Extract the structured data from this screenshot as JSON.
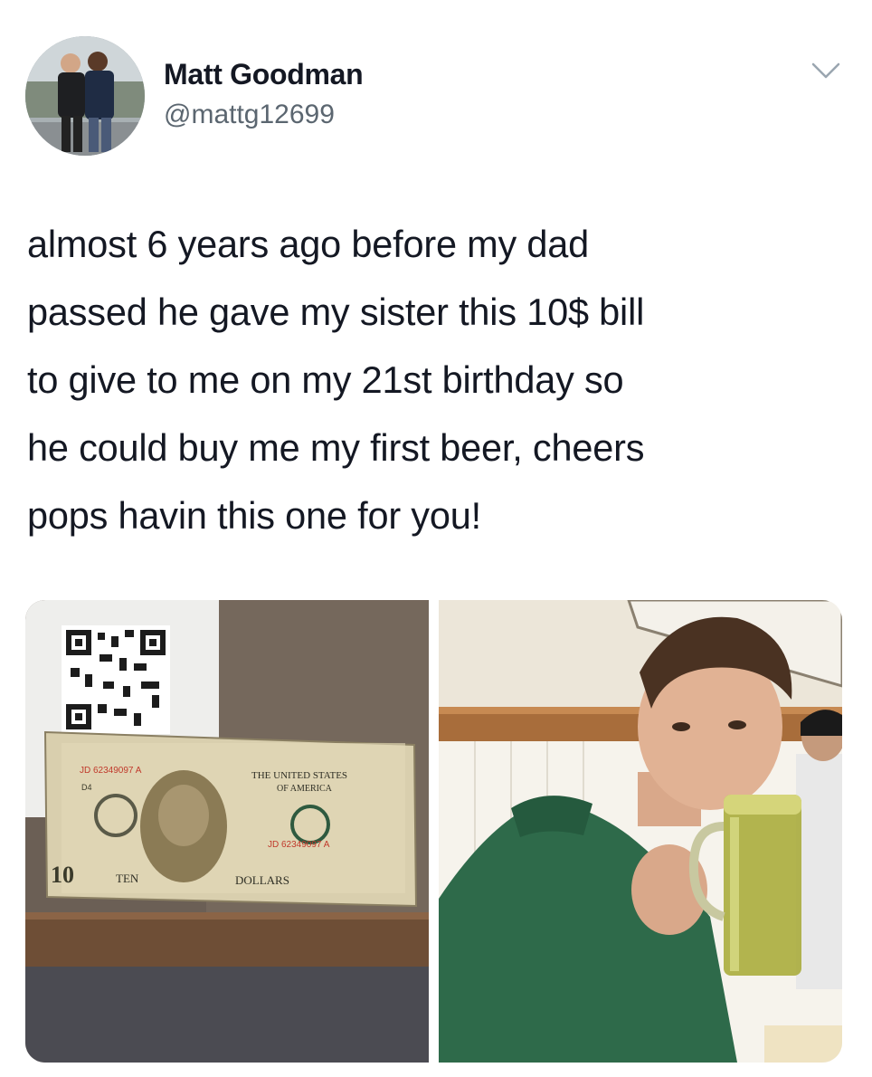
{
  "author": {
    "name": "Matt Goodman",
    "handle": "@mattg12699"
  },
  "tweet": {
    "lines": [
      "almost 6 years ago before my dad",
      "passed he gave my sister this 10$ bill",
      "to give to me on my 21st birthday so",
      "he could buy me my first beer, cheers",
      "pops havin this one for you!"
    ]
  },
  "media": {
    "bill": {
      "serial": "JD 62349097 A",
      "serial_back": "JD 62349097 A",
      "top_text": "THE UNITED STATES",
      "top_text2": "OF AMERICA",
      "value_word": "TEN",
      "denomination_word": "DOLLARS",
      "corner_value": "10",
      "small_code": "D4"
    }
  },
  "icons": {
    "menu": "chevron-down-icon"
  },
  "colors": {
    "text_primary": "#141823",
    "text_secondary": "#5b6670",
    "chevron": "#9aa6b0"
  }
}
